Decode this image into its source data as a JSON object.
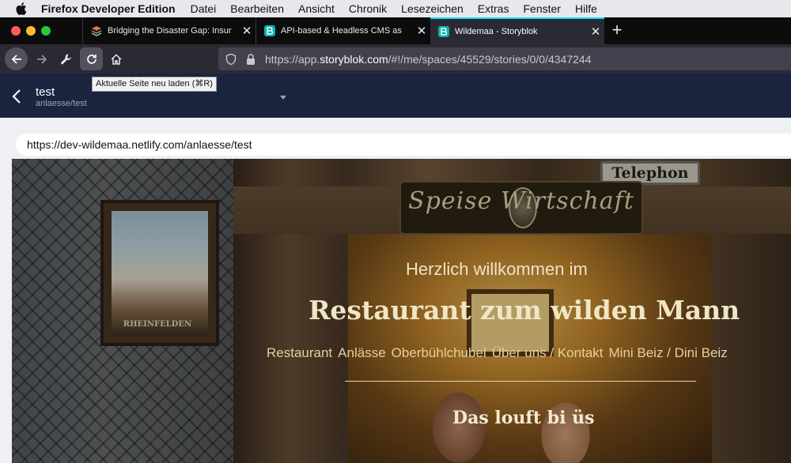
{
  "menubar": {
    "app_name": "Firefox Developer Edition",
    "items": [
      "Datei",
      "Bearbeiten",
      "Ansicht",
      "Chronik",
      "Lesezeichen",
      "Extras",
      "Fenster",
      "Hilfe"
    ]
  },
  "tabs": [
    {
      "title": "Bridging the Disaster Gap: Insur",
      "icon": "layers-favicon",
      "active": false
    },
    {
      "title": "API-based & Headless CMS as",
      "icon": "storyblok-favicon",
      "active": false
    },
    {
      "title": "Wildemaa - Storyblok",
      "icon": "storyblok-favicon",
      "active": true
    }
  ],
  "newtab_symbol": "+",
  "navbar": {
    "url_prefix": "https://app.",
    "url_host": "storyblok.com",
    "url_path": "/#!/me/spaces/45529/stories/0/0/4347244",
    "reload_tooltip": "Aktuelle Seite neu laden (⌘R)"
  },
  "storyblok": {
    "story_title": "test",
    "story_slug": "anlaesse/test"
  },
  "preview": {
    "url": "https://dev-wildemaa.netlify.com/anlaesse/test"
  },
  "site": {
    "sign_telephon": "Telephon",
    "sign_main": "Speise   Wirtschaft",
    "poster_label": "RHEINFELDEN",
    "welcome": "Herzlich willkommen im",
    "restaurant_name": "Restaurant zum wilden Mann",
    "nav": [
      "Restaurant",
      "Anlässe",
      "Oberbühlchubel",
      "Über uns / Kontakt",
      "Mini Beiz / Dini Beiz"
    ],
    "tagline": "Das louft bi üs"
  },
  "colors": {
    "tab_accent": "#00ddff",
    "storyblok_header": "#1b243f",
    "site_nav": "#e8cf9a"
  }
}
